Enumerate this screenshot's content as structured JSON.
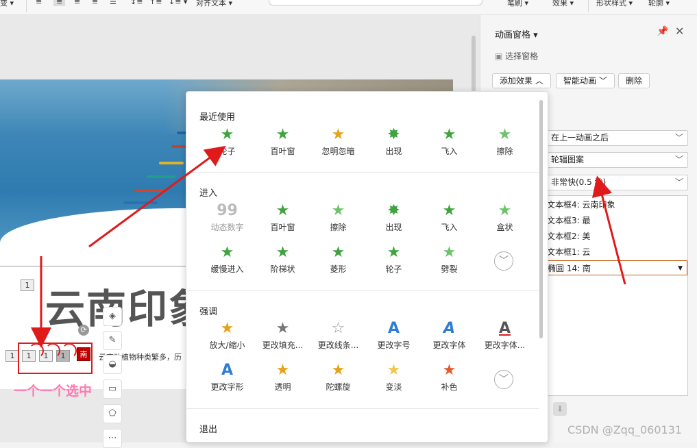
{
  "toolbar": {
    "align_text": "对齐文本",
    "pen": "笔刷",
    "effect": "效果",
    "shape_style": "形状样式",
    "outline": "轮廓"
  },
  "slide": {
    "title": "云南印象",
    "body_text": "云南动植物种类繁多，历",
    "solo_tag": "1",
    "tags": [
      "1",
      "1",
      "1",
      "1"
    ],
    "badge": "南",
    "annotation": "一个一个选中"
  },
  "panel": {
    "title": "动画窗格",
    "select_pane": "选择窗格",
    "add_effect": "添加效果",
    "smart_animation": "智能动画",
    "delete": "删除",
    "start": "在上一动画之后",
    "direction": "轮辐图案",
    "speed": "非常快(0.5 秒)",
    "items": [
      "文本框4: 云南印象",
      "文本框3: 最",
      "文本框2: 美",
      "文本框1: 云",
      "椭圆 14: 南"
    ]
  },
  "menu": {
    "recent": {
      "title": "最近使用",
      "items": [
        {
          "label": "轮子",
          "icon": "star-icon"
        },
        {
          "label": "百叶窗",
          "icon": "star-icon"
        },
        {
          "label": "忽明忽暗",
          "icon": "star-icon"
        },
        {
          "label": "出现",
          "icon": "star-icon"
        },
        {
          "label": "飞入",
          "icon": "star-icon"
        },
        {
          "label": "擦除",
          "icon": "star-icon"
        }
      ]
    },
    "enter": {
      "title": "进入",
      "items": [
        {
          "label": "动态数字",
          "icon": "digit-icon"
        },
        {
          "label": "百叶窗",
          "icon": "star-icon"
        },
        {
          "label": "擦除",
          "icon": "star-icon"
        },
        {
          "label": "出现",
          "icon": "star-icon"
        },
        {
          "label": "飞入",
          "icon": "star-icon"
        },
        {
          "label": "盒状",
          "icon": "star-icon"
        },
        {
          "label": "缓慢进入",
          "icon": "star-icon"
        },
        {
          "label": "阶梯状",
          "icon": "star-icon"
        },
        {
          "label": "菱形",
          "icon": "star-icon"
        },
        {
          "label": "轮子",
          "icon": "star-icon"
        },
        {
          "label": "劈裂",
          "icon": "star-icon"
        }
      ]
    },
    "emphasis": {
      "title": "强调",
      "items": [
        {
          "label": "放大/缩小",
          "icon": "star-icon"
        },
        {
          "label": "更改填充...",
          "icon": "star-icon"
        },
        {
          "label": "更改线条...",
          "icon": "star-icon"
        },
        {
          "label": "更改字号",
          "icon": "font-icon"
        },
        {
          "label": "更改字体",
          "icon": "font-icon"
        },
        {
          "label": "更改字体...",
          "icon": "font-icon"
        },
        {
          "label": "更改字形",
          "icon": "font-icon"
        },
        {
          "label": "透明",
          "icon": "star-icon"
        },
        {
          "label": "陀螺旋",
          "icon": "star-icon"
        },
        {
          "label": "变淡",
          "icon": "star-icon"
        },
        {
          "label": "补色",
          "icon": "star-icon"
        }
      ]
    },
    "exit": {
      "title": "退出"
    }
  },
  "watermark": "CSDN @Zqq_060131",
  "colors": {
    "accent_red": "#e01a1a",
    "annotation_pink": "#ff7ab1",
    "star_green": "#3fa33f",
    "badge_red": "#c00000"
  }
}
